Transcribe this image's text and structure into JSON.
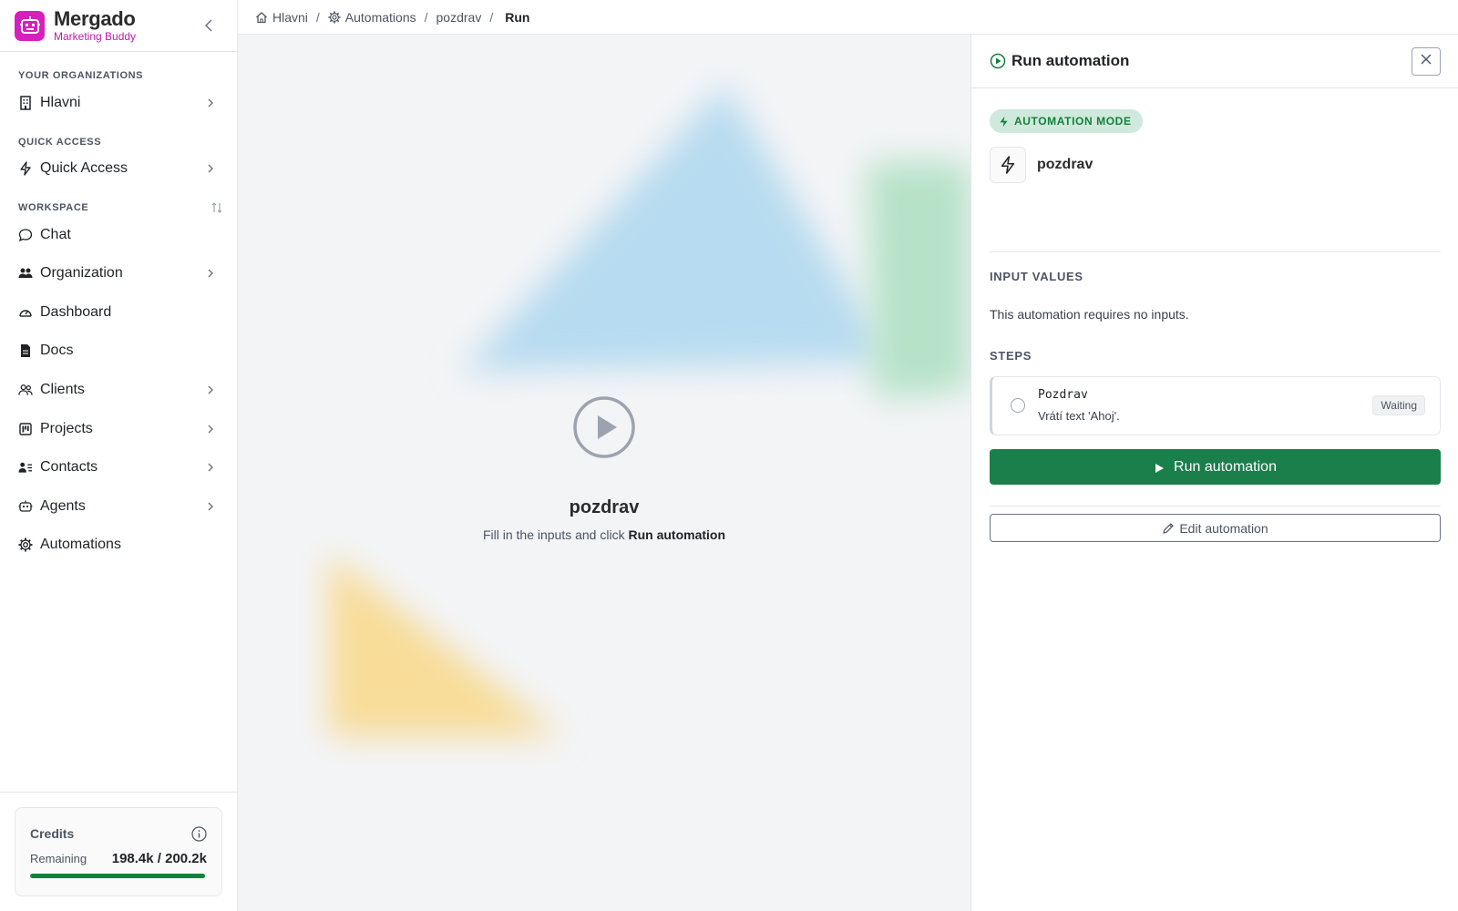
{
  "brand": {
    "name": "Mergado",
    "subtitle": "Marketing Buddy",
    "accent": "#d61fbf"
  },
  "sidebar": {
    "sections": {
      "organizations": "YOUR ORGANIZATIONS",
      "quick_access": "QUICK ACCESS",
      "workspace": "WORKSPACE"
    },
    "org_item": {
      "label": "Hlavni",
      "icon": "building-icon"
    },
    "quick_item": {
      "label": "Quick Access",
      "icon": "bolt-icon"
    },
    "items": [
      {
        "label": "Chat",
        "icon": "chat-bubble-icon",
        "expandable": false
      },
      {
        "label": "Organization",
        "icon": "users-icon",
        "expandable": true
      },
      {
        "label": "Dashboard",
        "icon": "gauge-icon",
        "expandable": false
      },
      {
        "label": "Docs",
        "icon": "document-icon",
        "expandable": false
      },
      {
        "label": "Clients",
        "icon": "user-group-icon",
        "expandable": true
      },
      {
        "label": "Projects",
        "icon": "kanban-icon",
        "expandable": true
      },
      {
        "label": "Contacts",
        "icon": "contact-card-icon",
        "expandable": true
      },
      {
        "label": "Agents",
        "icon": "robot-icon",
        "expandable": true
      },
      {
        "label": "Automations",
        "icon": "gear-icon",
        "expandable": false
      }
    ],
    "credits": {
      "title": "Credits",
      "remaining_label": "Remaining",
      "value": "198.4k / 200.2k",
      "fraction": 0.991,
      "bar_color": "#15803d"
    }
  },
  "breadcrumb": {
    "items": [
      "Hlavni",
      "Automations",
      "pozdrav"
    ],
    "current": "Run",
    "separator": "/"
  },
  "main": {
    "title": "pozdrav",
    "hint_prefix": "Fill in the inputs and click",
    "hint_action": "Run automation"
  },
  "panel": {
    "title": "Run automation",
    "mode_badge": "AUTOMATION MODE",
    "automation_name": "pozdrav",
    "input_values_label": "INPUT VALUES",
    "no_inputs_text": "This automation requires no inputs.",
    "steps_label": "STEPS",
    "steps": [
      {
        "name": "Pozdrav",
        "description": "Vrátí text 'Ahoj'.",
        "status": "Waiting"
      }
    ],
    "run_button": "Run automation",
    "edit_button": "Edit automation",
    "primary_color": "#1b7f4b"
  }
}
